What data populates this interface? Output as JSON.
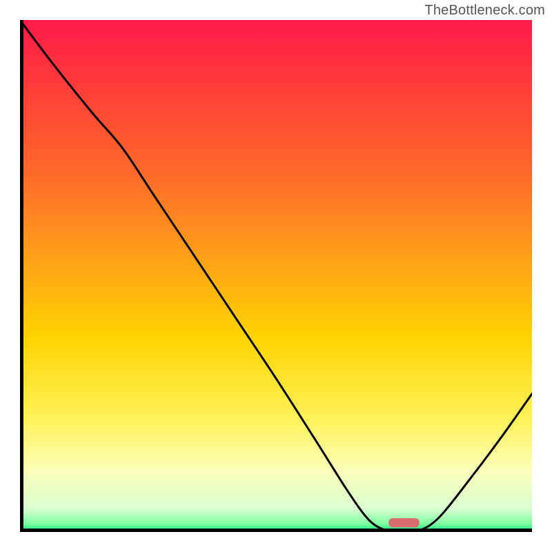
{
  "watermark": "TheBottleneck.com",
  "chart_data": {
    "type": "line",
    "title": "",
    "xlabel": "",
    "ylabel": "",
    "xlim": [
      0,
      100
    ],
    "ylim": [
      0,
      100
    ],
    "background_gradient_stops": [
      {
        "offset": 0.0,
        "color": "#ff1a4b"
      },
      {
        "offset": 0.12,
        "color": "#ff3a3a"
      },
      {
        "offset": 0.3,
        "color": "#ff6a2a"
      },
      {
        "offset": 0.48,
        "color": "#ffa516"
      },
      {
        "offset": 0.62,
        "color": "#ffd400"
      },
      {
        "offset": 0.78,
        "color": "#fff25a"
      },
      {
        "offset": 0.88,
        "color": "#fcffb8"
      },
      {
        "offset": 0.955,
        "color": "#d8ffd0"
      },
      {
        "offset": 0.985,
        "color": "#7aff9e"
      },
      {
        "offset": 1.0,
        "color": "#00e676"
      }
    ],
    "curve_points": [
      {
        "x": 0.0,
        "y": 100.0
      },
      {
        "x": 6.0,
        "y": 92.0
      },
      {
        "x": 14.0,
        "y": 82.0
      },
      {
        "x": 20.0,
        "y": 75.0
      },
      {
        "x": 26.0,
        "y": 66.0
      },
      {
        "x": 34.0,
        "y": 54.0
      },
      {
        "x": 42.0,
        "y": 42.0
      },
      {
        "x": 50.0,
        "y": 30.0
      },
      {
        "x": 58.0,
        "y": 17.5
      },
      {
        "x": 64.0,
        "y": 8.0
      },
      {
        "x": 68.0,
        "y": 2.5
      },
      {
        "x": 71.0,
        "y": 0.5
      },
      {
        "x": 74.0,
        "y": 0.0
      },
      {
        "x": 78.0,
        "y": 0.3
      },
      {
        "x": 82.0,
        "y": 3.0
      },
      {
        "x": 88.0,
        "y": 10.5
      },
      {
        "x": 94.0,
        "y": 18.5
      },
      {
        "x": 100.0,
        "y": 27.0
      }
    ],
    "marker": {
      "x_center": 75.0,
      "x_half_width": 3.0,
      "y_center": 1.8,
      "y_half_height": 0.9,
      "color": "#d96d6d"
    },
    "curve_stroke": "#000000",
    "curve_stroke_width": 3
  }
}
